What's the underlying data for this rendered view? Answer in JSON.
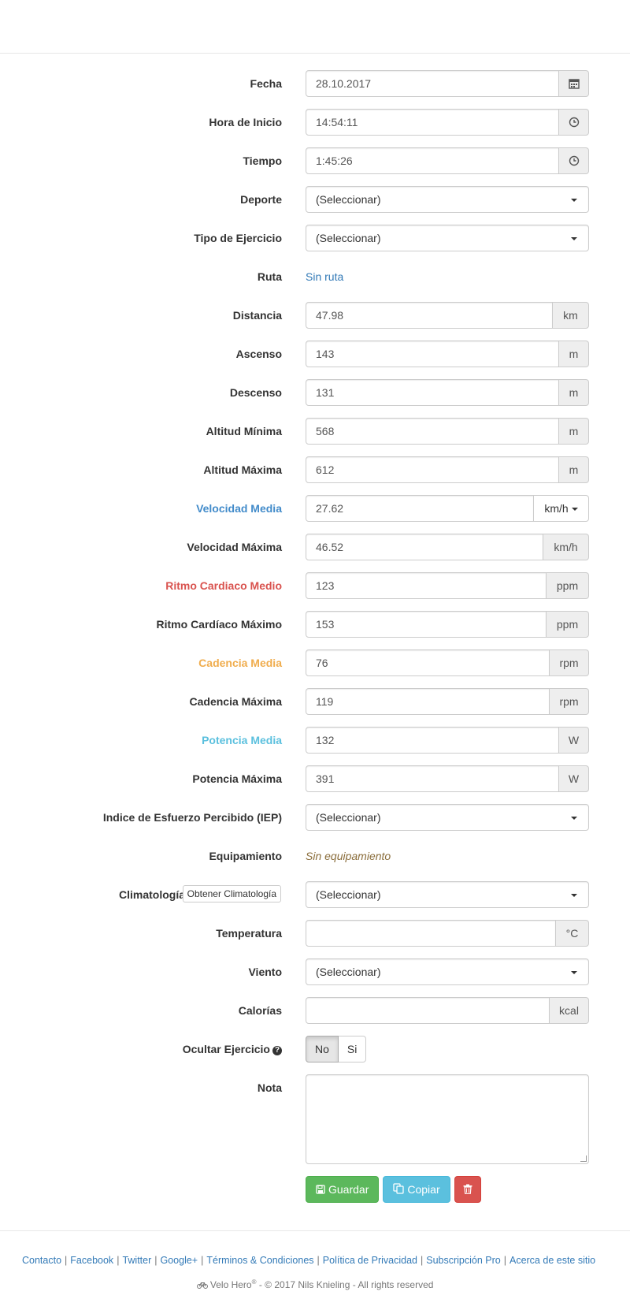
{
  "fields": {
    "fecha": {
      "label": "Fecha",
      "value": "28.10.2017",
      "addon_icon": "calendar-icon"
    },
    "hora": {
      "label": "Hora de Inicio",
      "value": "14:54:11",
      "addon_icon": "clock-icon"
    },
    "tiempo": {
      "label": "Tiempo",
      "value": "1:45:26",
      "addon_icon": "clock-icon"
    },
    "deporte": {
      "label": "Deporte",
      "selected": "(Seleccionar)"
    },
    "tipo": {
      "label": "Tipo de Ejercicio",
      "selected": "(Seleccionar)"
    },
    "ruta": {
      "label": "Ruta",
      "value": "Sin ruta"
    },
    "distancia": {
      "label": "Distancia",
      "value": "47.98",
      "unit": "km"
    },
    "ascenso": {
      "label": "Ascenso",
      "value": "143",
      "unit": "m"
    },
    "descenso": {
      "label": "Descenso",
      "value": "131",
      "unit": "m"
    },
    "alt_min": {
      "label": "Altitud Mínima",
      "value": "568",
      "unit": "m"
    },
    "alt_max": {
      "label": "Altitud Máxima",
      "value": "612",
      "unit": "m"
    },
    "vel_media": {
      "label": "Velocidad Media",
      "value": "27.62",
      "unit": "km/h"
    },
    "vel_max": {
      "label": "Velocidad Máxima",
      "value": "46.52",
      "unit": "km/h"
    },
    "rc_medio": {
      "label": "Ritmo Cardiaco Medio",
      "value": "123",
      "unit": "ppm"
    },
    "rc_max": {
      "label": "Ritmo Cardíaco Máximo",
      "value": "153",
      "unit": "ppm"
    },
    "cad_media": {
      "label": "Cadencia Media",
      "value": "76",
      "unit": "rpm"
    },
    "cad_max": {
      "label": "Cadencia Máxima",
      "value": "119",
      "unit": "rpm"
    },
    "pot_media": {
      "label": "Potencia Media",
      "value": "132",
      "unit": "W"
    },
    "pot_max": {
      "label": "Potencia Máxima",
      "value": "391",
      "unit": "W"
    },
    "iep": {
      "label": "Indice de Esfuerzo Percibido (IEP)",
      "selected": "(Seleccionar)"
    },
    "equipamiento": {
      "label": "Equipamiento",
      "value": "Sin equipamiento"
    },
    "clima": {
      "label": "Climatología",
      "button": "Obtener Climatología",
      "selected": "(Seleccionar)"
    },
    "temperatura": {
      "label": "Temperatura",
      "value": "",
      "unit": "°C"
    },
    "viento": {
      "label": "Viento",
      "selected": "(Seleccionar)"
    },
    "calorias": {
      "label": "Calorías",
      "value": "",
      "unit": "kcal"
    },
    "ocultar": {
      "label": "Ocultar Ejercicio",
      "no": "No",
      "si": "Si",
      "selected": "No"
    },
    "nota": {
      "label": "Nota",
      "value": ""
    }
  },
  "actions": {
    "save": "Guardar",
    "copy": "Copiar"
  },
  "footer": {
    "links": [
      "Contacto",
      "Facebook",
      "Twitter",
      "Google+",
      "Términos & Condiciones",
      "Política de Privacidad",
      "Subscripción Pro",
      "Acerca de este sitio"
    ],
    "brand": "Velo Hero",
    "copyright": "- © 2017 Nils Knieling - All rights reserved"
  },
  "colors": {
    "blue": "#428bca",
    "red": "#d9534f",
    "orange": "#f0ad4e",
    "cyan": "#5bc0de",
    "success": "#5cb85c",
    "danger": "#d9534f"
  }
}
